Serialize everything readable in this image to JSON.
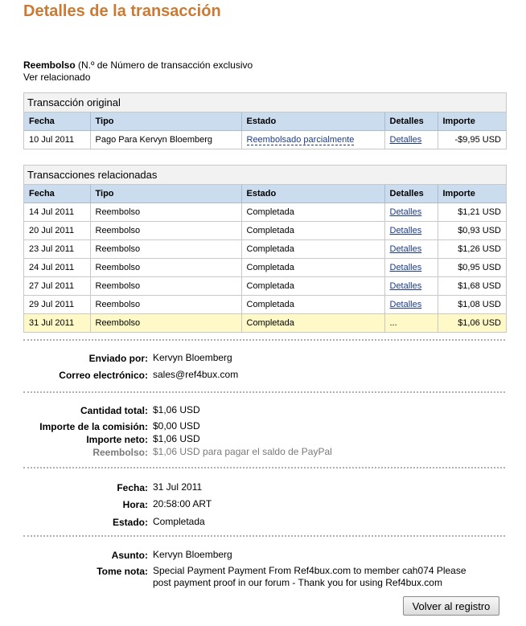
{
  "page": {
    "title": "Detalles de la transacción"
  },
  "intro": {
    "type_label": "Reembolso",
    "txn_note": "(N.º de Número de transacción exclusivo",
    "related_link": "Ver relacionado"
  },
  "original": {
    "title": "Transacción original",
    "headers": {
      "date": "Fecha",
      "type": "Tipo",
      "status": "Estado",
      "details": "Detalles",
      "amount": "Importe"
    },
    "row": {
      "date": "10 Jul 2011",
      "type": "Pago Para Kervyn Bloemberg",
      "status": "Reembolsado parcialmente",
      "details": "Detalles",
      "amount": "-$9,95 USD"
    }
  },
  "related": {
    "title": "Transacciones relacionadas",
    "headers": {
      "date": "Fecha",
      "type": "Tipo",
      "status": "Estado",
      "details": "Detalles",
      "amount": "Importe"
    },
    "rows": [
      {
        "date": "14 Jul 2011",
        "type": "Reembolso",
        "status": "Completada",
        "details": "Detalles",
        "amount": "$1,21 USD"
      },
      {
        "date": "20 Jul 2011",
        "type": "Reembolso",
        "status": "Completada",
        "details": "Detalles",
        "amount": "$0,93 USD"
      },
      {
        "date": "23 Jul 2011",
        "type": "Reembolso",
        "status": "Completada",
        "details": "Detalles",
        "amount": "$1,26 USD"
      },
      {
        "date": "24 Jul 2011",
        "type": "Reembolso",
        "status": "Completada",
        "details": "Detalles",
        "amount": "$0,95 USD"
      },
      {
        "date": "27 Jul 2011",
        "type": "Reembolso",
        "status": "Completada",
        "details": "Detalles",
        "amount": "$1,68 USD"
      },
      {
        "date": "29 Jul 2011",
        "type": "Reembolso",
        "status": "Completada",
        "details": "Detalles",
        "amount": "$1,08 USD"
      },
      {
        "date": "31 Jul 2011",
        "type": "Reembolso",
        "status": "Completada",
        "details": "...",
        "amount": "$1,06 USD"
      }
    ]
  },
  "sender": {
    "sent_by_label": "Enviado por:",
    "sent_by": "Kervyn Bloemberg",
    "email_label": "Correo electrónico:",
    "email": "sales@ref4bux.com"
  },
  "amounts": {
    "total_label": "Cantidad total:",
    "total": "$1,06 USD",
    "fee_label": "Importe de la comisión:",
    "fee": "$0,00 USD",
    "net_label": "Importe neto:",
    "net": "$1,06 USD",
    "refund_label": "Reembolso:",
    "refund": "$1,06 USD para pagar el saldo de PayPal"
  },
  "timing": {
    "date_label": "Fecha:",
    "date": "31 Jul 2011",
    "time_label": "Hora:",
    "time": "20:58:00 ART",
    "status_label": "Estado:",
    "status": "Completada"
  },
  "note": {
    "subject_label": "Asunto:",
    "subject": "Kervyn Bloemberg",
    "note_label": "Tome nota:",
    "note_line1": "Special Payment Payment From Ref4bux.com to member cah074 Please",
    "note_line2": "post payment proof in our forum - Thank you for using Ref4bux.com"
  },
  "actions": {
    "back_label": "Volver al registro"
  },
  "colors": {
    "title": "#cc7a33",
    "header_bg": "#cbdcef",
    "highlight_row": "#fff9c8",
    "link": "#1a3a8a"
  }
}
